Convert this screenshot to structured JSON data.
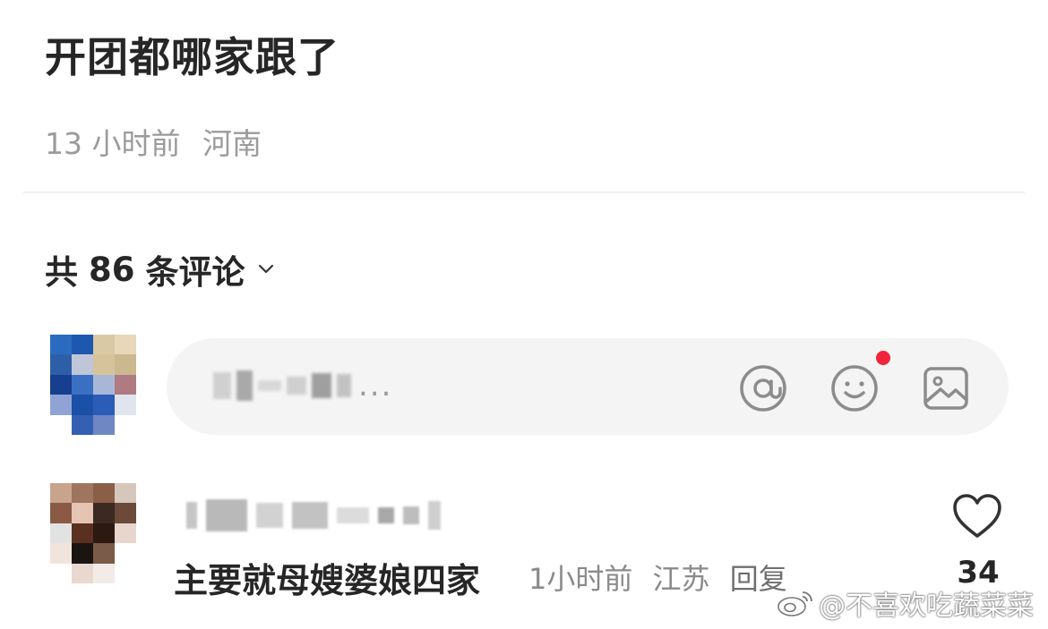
{
  "post": {
    "title": "开团都哪家跟了",
    "time": "13 小时前",
    "location": "河南"
  },
  "comments_header": {
    "prefix": "共",
    "count": "86",
    "suffix": "条评论",
    "toggle_icon": "chevron-down-icon"
  },
  "composer": {
    "placeholder_suffix": "...",
    "icons": [
      "at-icon",
      "emoji-icon",
      "image-icon"
    ]
  },
  "comment": {
    "text": "主要就母嫂婆娘四家",
    "time": "1小时前",
    "location": "江苏",
    "reply_label": "回复",
    "like_count": "34"
  },
  "watermark": {
    "text": "@不喜欢吃蔬菜菜"
  },
  "colors": {
    "badge_red": "#f0243c",
    "meta_gray": "#9b9b9b",
    "composer_bg": "#f4f4f4"
  }
}
